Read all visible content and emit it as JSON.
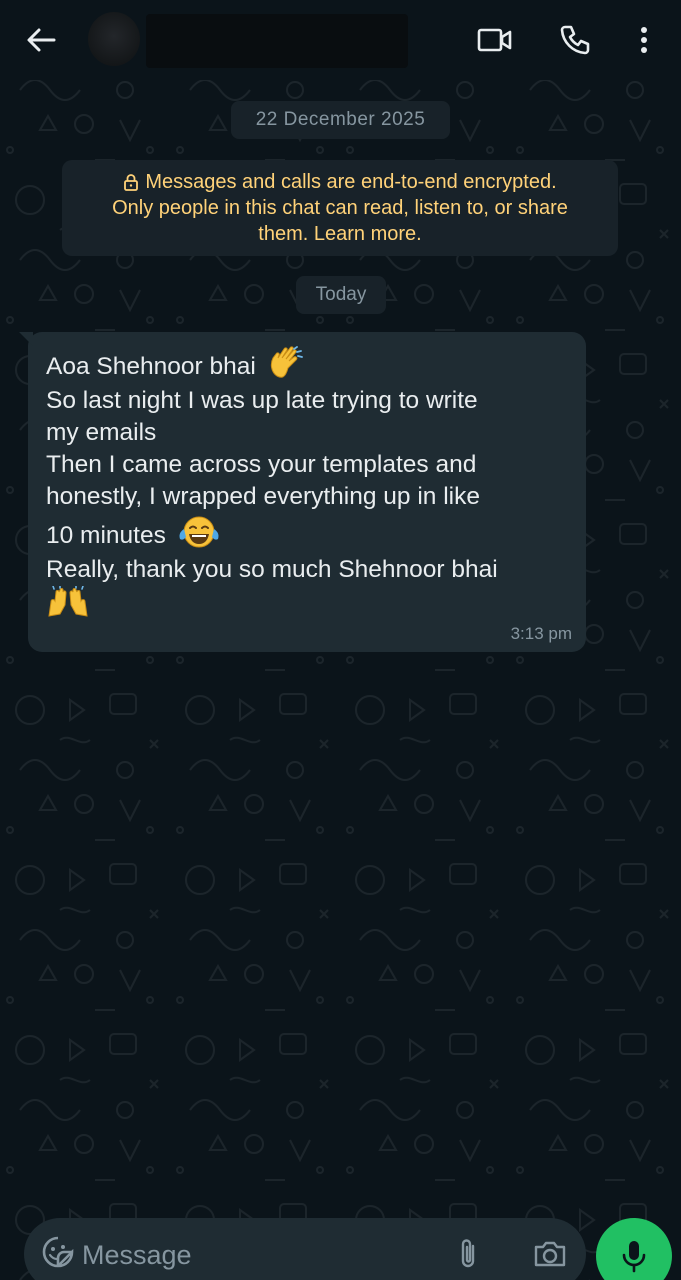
{
  "header": {
    "back_icon": "arrow-left-icon",
    "video_icon": "video-call-icon",
    "call_icon": "phone-call-icon",
    "menu_icon": "more-vertical-icon"
  },
  "chat": {
    "date_separator": "22 December 2025",
    "encryption_notice": {
      "line1": "Messages and calls are end-to-end encrypted.",
      "line2": "Only people in this chat can read, listen to, or share",
      "line3": "them. Learn more.",
      "icon": "lock-icon"
    },
    "today_separator": "Today",
    "message": {
      "direction": "incoming",
      "lines": [
        "Aoa Shehnoor bhai",
        "So last night I was up late trying to write",
        "my emails",
        "Then I came across your templates and",
        "honestly, I wrapped everything up in like",
        "10 minutes",
        "Really, thank you so much Shehnoor bhai"
      ],
      "emojis": [
        "waving-hand-emoji",
        "tears-of-joy-emoji",
        "raising-hands-emoji"
      ],
      "time": "3:13 pm"
    }
  },
  "composer": {
    "placeholder": "Message",
    "emoji_icon": "sticker-emoji-icon",
    "attach_icon": "paperclip-icon",
    "camera_icon": "camera-icon",
    "mic_icon": "microphone-icon"
  },
  "colors": {
    "background": "#0b141a",
    "bubble": "#1f2c33",
    "chip": "#182229",
    "encryption_text": "#ffd279",
    "accent_green": "#21c063"
  }
}
